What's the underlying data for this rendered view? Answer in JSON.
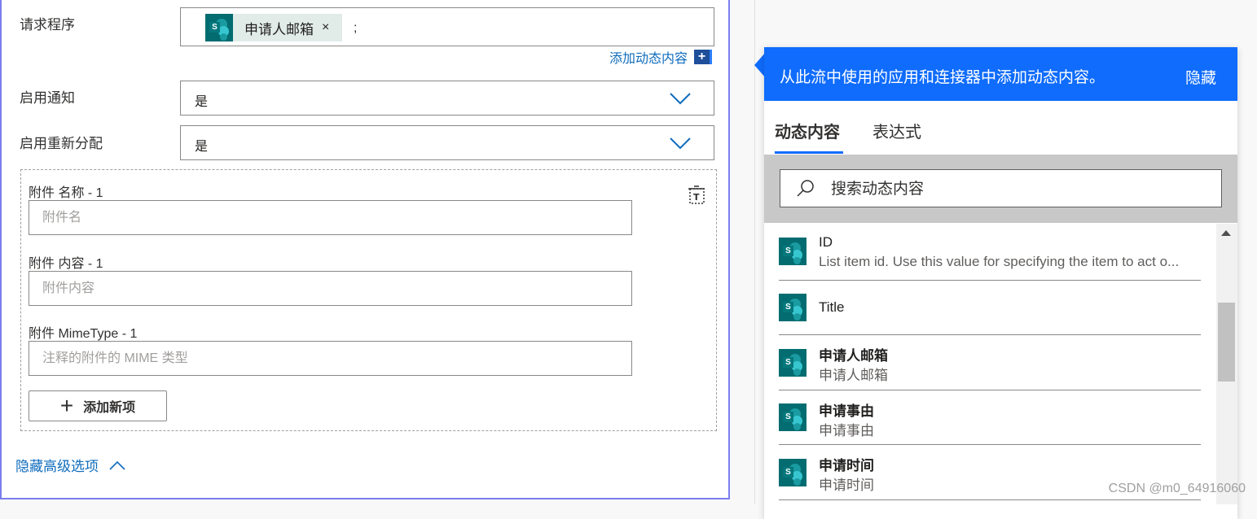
{
  "form": {
    "requester_label": "请求程序",
    "requester_token": "申请人邮箱",
    "requester_token_remove": "×",
    "requester_separator": ";",
    "add_dynamic_content": "添加动态内容",
    "enable_notification_label": "启用通知",
    "enable_notification_value": "是",
    "enable_reassignment_label": "启用重新分配",
    "enable_reassignment_value": "是",
    "attachments": [
      {
        "label": "附件 名称 - 1",
        "placeholder": "附件名"
      },
      {
        "label": "附件 内容 - 1",
        "placeholder": "附件内容"
      },
      {
        "label": "附件 MimeType - 1",
        "placeholder": "注释的附件的 MIME 类型"
      }
    ],
    "add_new_item": "添加新项",
    "hide_advanced": "隐藏高级选项"
  },
  "panel": {
    "header_message": "从此流中使用的应用和连接器中添加动态内容。",
    "hide_label": "隐藏",
    "tabs": [
      "动态内容",
      "表达式"
    ],
    "active_tab": 0,
    "search_placeholder": "搜索动态内容",
    "items": [
      {
        "name": "ID",
        "desc": "List item id. Use this value for specifying the item to act o..."
      },
      {
        "name": "Title",
        "desc": ""
      },
      {
        "name": "申请人邮箱",
        "desc": "申请人邮箱"
      },
      {
        "name": "申请事由",
        "desc": "申请事由"
      },
      {
        "name": "申请时间",
        "desc": "申请时间"
      }
    ]
  },
  "watermark": "CSDN @m0_64916060",
  "colors": {
    "accent": "#0f6cfc",
    "link": "#0f6cbd",
    "sharepoint": "#036c70",
    "card_border": "#7a7ef0"
  }
}
